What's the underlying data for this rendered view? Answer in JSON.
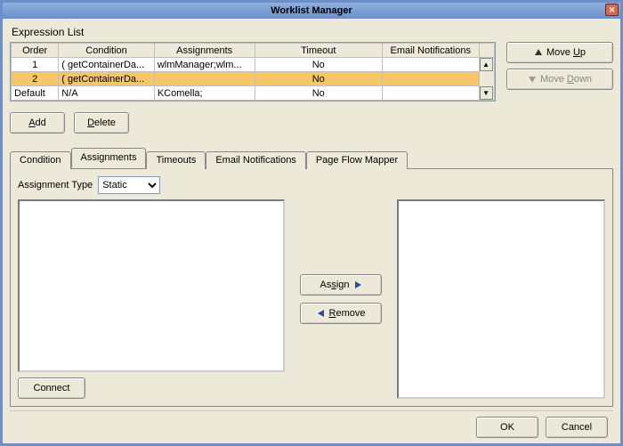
{
  "window": {
    "title": "Worklist Manager"
  },
  "expression_list_label": "Expression List",
  "table": {
    "headers": {
      "order": "Order",
      "condition": "Condition",
      "assignments": "Assignments",
      "timeout": "Timeout",
      "email": "Email Notifications"
    },
    "rows": [
      {
        "order": "1",
        "condition": "( getContainerDa...",
        "assignments": "wlmManager;wlm...",
        "timeout": "No",
        "email": "",
        "selected": false
      },
      {
        "order": "2",
        "condition": "( getContainerDa...",
        "assignments": "",
        "timeout": "No",
        "email": "",
        "selected": true
      },
      {
        "order": "Default",
        "condition": "N/A",
        "assignments": "KComella;",
        "timeout": "No",
        "email": "",
        "selected": false
      }
    ]
  },
  "buttons": {
    "move_up": "Move Up",
    "move_up_u": "U",
    "move_down": "Move Down",
    "move_down_u": "D",
    "add": "Add",
    "add_u": "A",
    "delete": "Delete",
    "delete_u": "D",
    "assign": "Assign",
    "assign_u": "s",
    "remove": "Remove",
    "remove_u": "R",
    "connect": "Connect",
    "ok": "OK",
    "cancel": "Cancel"
  },
  "tabs": {
    "condition": "Condition",
    "condition_u": "C",
    "assignments": "Assignments",
    "timeouts": "Timeouts",
    "timeouts_u": "T",
    "email": "Email Notifications",
    "email_u": "E",
    "page_flow": "Page Flow Mapper",
    "page_flow_u": "P"
  },
  "assignment_type": {
    "label": "Assignment Type",
    "value": "Static"
  }
}
